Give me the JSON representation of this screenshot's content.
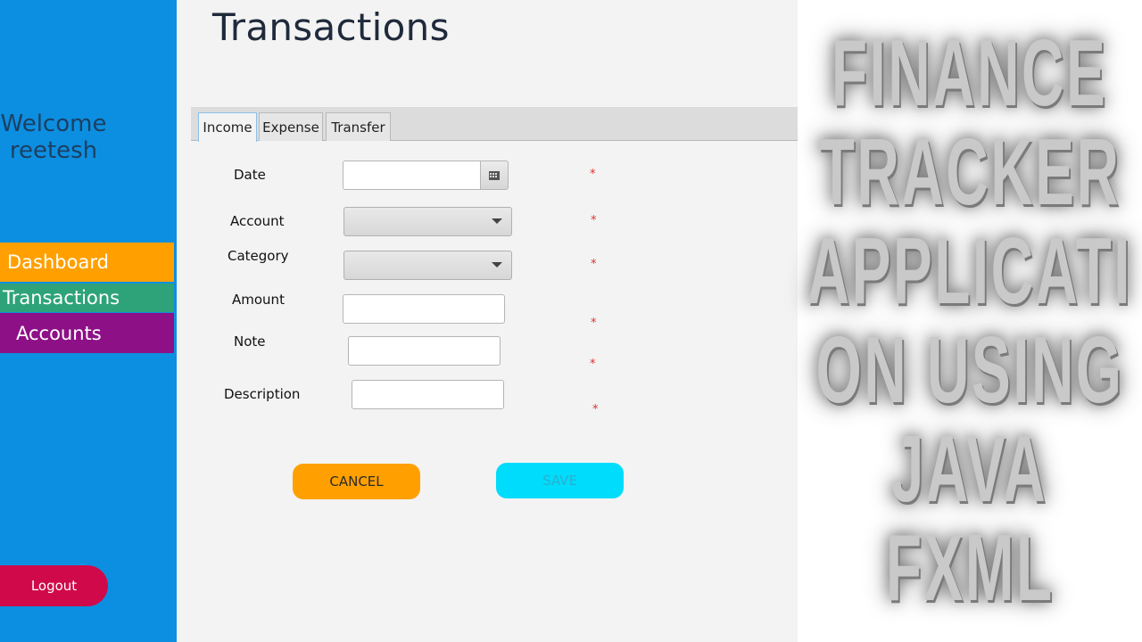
{
  "sidebar": {
    "welcome_line1": "Welcome",
    "welcome_line2": "reetesh",
    "nav": {
      "dashboard": "Dashboard",
      "transactions": "Transactions",
      "accounts": "Accounts"
    },
    "logout_label": "Logout",
    "colors": {
      "background": "#0c8fe0",
      "dashboard": "#ffa000",
      "transactions": "#2ea37a",
      "accounts": "#8d1086",
      "logout": "#d0094a"
    }
  },
  "main": {
    "title": "Transactions",
    "tabs": [
      {
        "label": "Income",
        "active": true
      },
      {
        "label": "Expense",
        "active": false
      },
      {
        "label": "Transfer",
        "active": false
      }
    ],
    "form": {
      "date_label": "Date",
      "date_value": "",
      "calendar_icon": "calendar-icon",
      "account_label": "Account",
      "account_value": "",
      "category_label": "Category",
      "category_value": "",
      "amount_label": "Amount",
      "amount_value": "",
      "note_label": "Note",
      "note_value": "",
      "description_label": "Description",
      "description_value": "",
      "required_marker": "*"
    },
    "buttons": {
      "cancel": "CANCEL",
      "save": "SAVE"
    }
  },
  "banner": {
    "lines": [
      "FINANCE",
      "TRACKER",
      "APPLICATI",
      "ON USING",
      "JAVA",
      "FXML"
    ]
  }
}
